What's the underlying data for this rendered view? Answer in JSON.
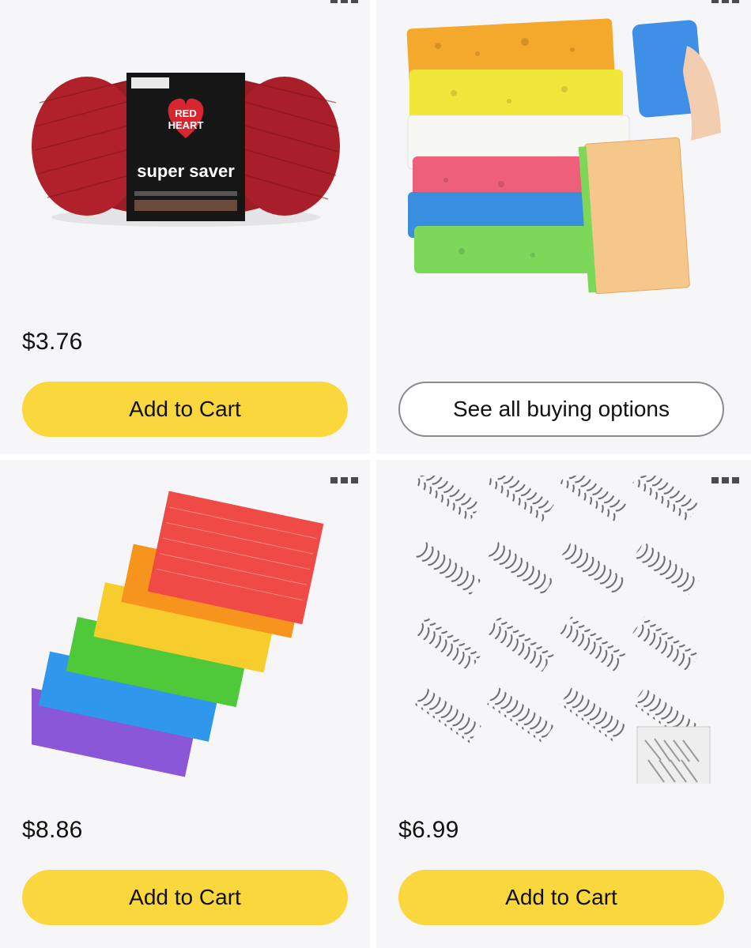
{
  "products": [
    {
      "image": "red-yarn-skein",
      "image_text": {
        "brand_line1": "RED",
        "brand_line2": "HEART",
        "product": "super saver"
      },
      "price": "$3.76",
      "button": "Add to Cart"
    },
    {
      "image": "colorful-sponges",
      "price": "",
      "button": "See all buying options"
    },
    {
      "image": "rainbow-index-cards",
      "price": "$8.86",
      "button": "Add to Cart"
    },
    {
      "image": "metal-springs",
      "price": "$6.99",
      "button": "Add to Cart"
    }
  ],
  "colors": {
    "add_to_cart_bg": "#fad73d",
    "card_bg": "#f6f6f8",
    "outline_border": "#8a8a8f"
  },
  "icons": [
    "more-options-icon"
  ]
}
